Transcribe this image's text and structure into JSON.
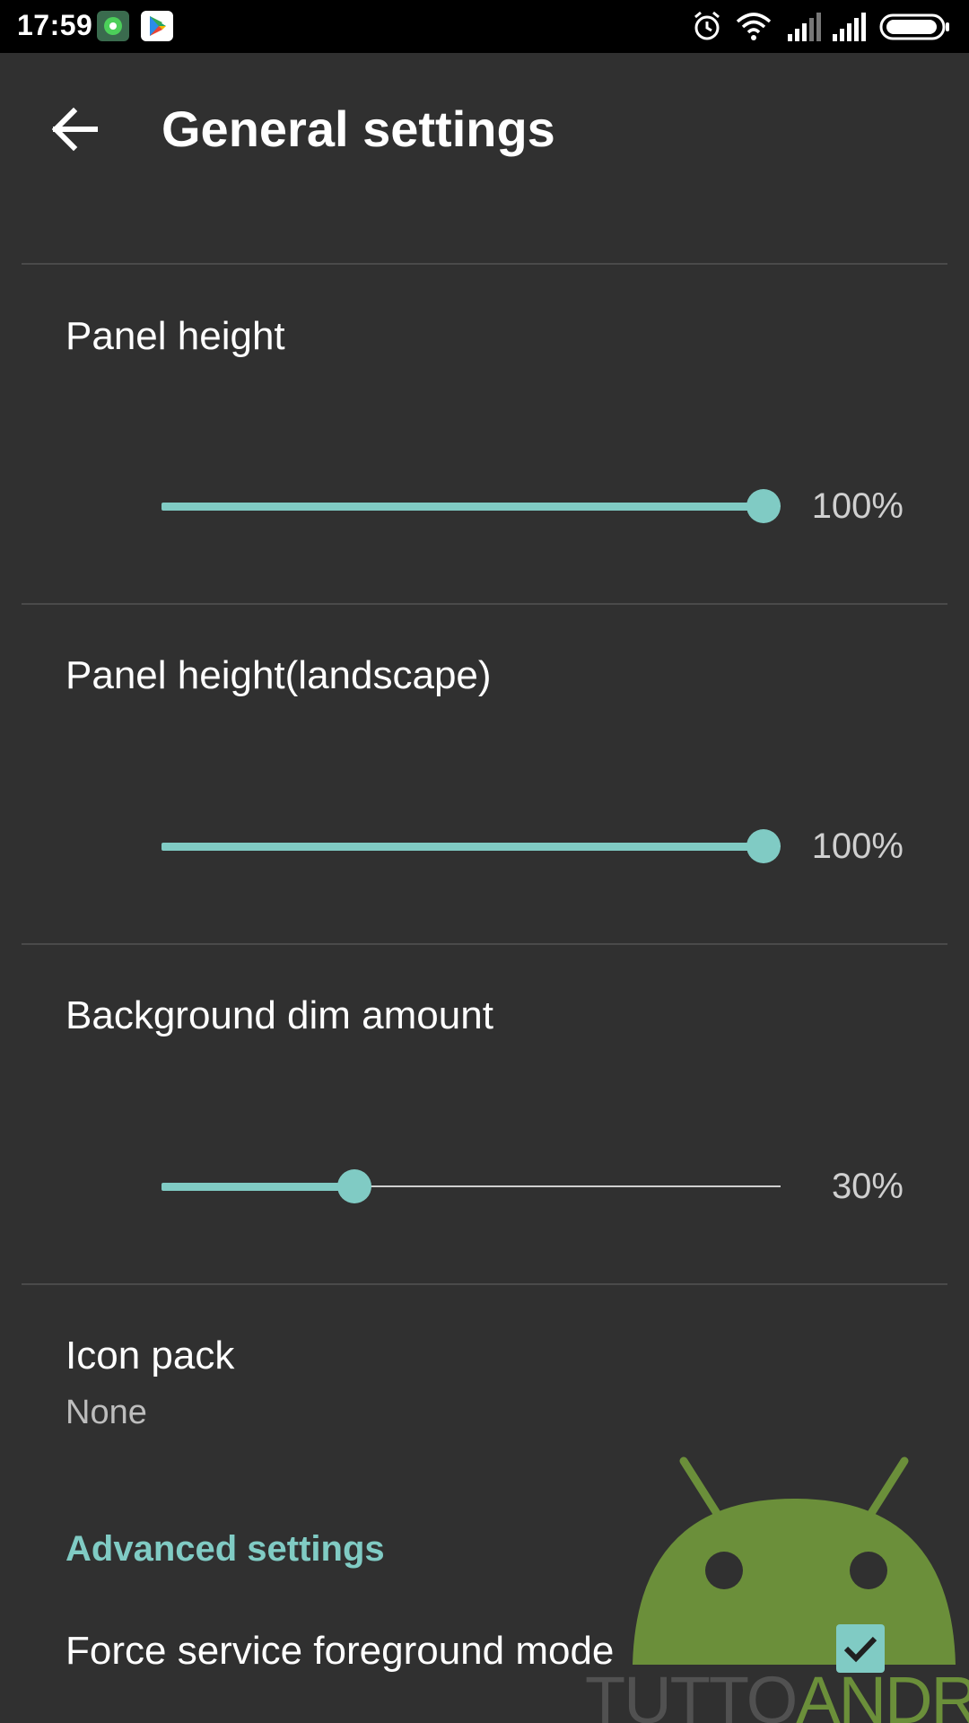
{
  "status_bar": {
    "time": "17:59",
    "icons": [
      "app-notification-icon",
      "play-store-icon",
      "alarm-icon",
      "wifi-icon",
      "signal-icon",
      "signal-icon",
      "battery-icon"
    ]
  },
  "app_bar": {
    "title": "General settings",
    "back_icon": "arrow-back-icon"
  },
  "preferences": [
    {
      "title": "Panel height",
      "value": 100,
      "value_label": "100%"
    },
    {
      "title": "Panel height(landscape)",
      "value": 100,
      "value_label": "100%"
    },
    {
      "title": "Background dim amount",
      "value": 30,
      "value_label": "30%"
    }
  ],
  "icon_pack": {
    "title": "Icon pack",
    "summary": "None"
  },
  "advanced": {
    "category_title": "Advanced settings",
    "force_service": {
      "title": "Force service foreground mode",
      "checked": true
    }
  },
  "watermark": {
    "text_light": "TUTTO",
    "text_brand": "ANDROID"
  },
  "colors": {
    "background": "#303030",
    "accent": "#80cbc4",
    "status_bar": "#000000",
    "divider": "#4a4a4a",
    "watermark_green": "#6b8f3a"
  }
}
